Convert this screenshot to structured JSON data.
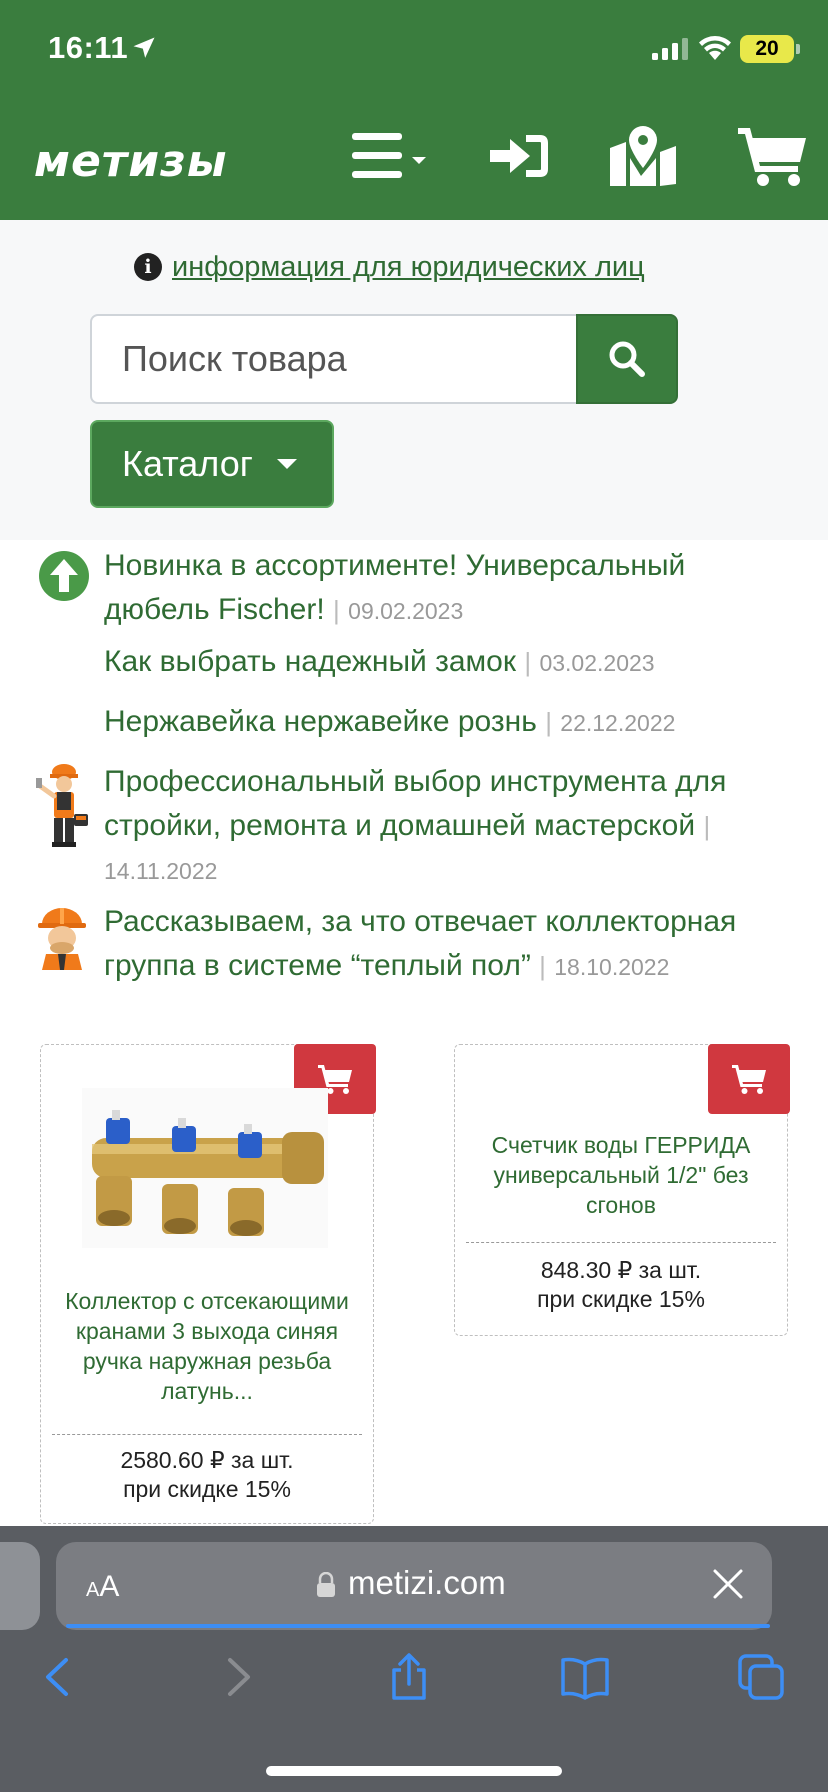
{
  "status_bar": {
    "time": "16:11",
    "battery": "20"
  },
  "header": {
    "logo": "метизы",
    "icons": [
      "menu-icon",
      "login-icon",
      "map-icon",
      "cart-icon"
    ],
    "brand_color": "#3a7d3e"
  },
  "legal": {
    "link_text": "информация для юридических лиц"
  },
  "search": {
    "placeholder": "Поиск товара"
  },
  "catalog": {
    "label": "Каталог"
  },
  "news": [
    {
      "title": "Новинка в ассортименте! Универсальный дюбель Fischer!",
      "date": "09.02.2023"
    },
    {
      "title": "Как выбрать надежный замок",
      "date": "03.02.2023"
    },
    {
      "title": "Нержавейка нержавейке рознь",
      "date": "22.12.2022"
    },
    {
      "title": "Профессиональный выбор инструмента для стройки, ремонта и домашней мастерской",
      "date": "14.11.2022"
    },
    {
      "title": "Рассказываем, за что отвечает коллекторная группа в системе “теплый пол”",
      "date": "18.10.2022"
    }
  ],
  "news_separator": "|",
  "products": [
    {
      "title": "Коллектор с отсекающими кранами 3 выхода синяя ручка наружная резьба латунь...",
      "price": "2580.60 ₽ за шт.",
      "discount": "при скидке 15%"
    },
    {
      "title": "Счетчик воды ГЕРРИДА универсальный 1/2\" без сгонов",
      "price": "848.30 ₽ за шт.",
      "discount": "при скидке 15%"
    }
  ],
  "browser": {
    "aa_small": "A",
    "aa_big": "A",
    "url": "metizi.com"
  }
}
